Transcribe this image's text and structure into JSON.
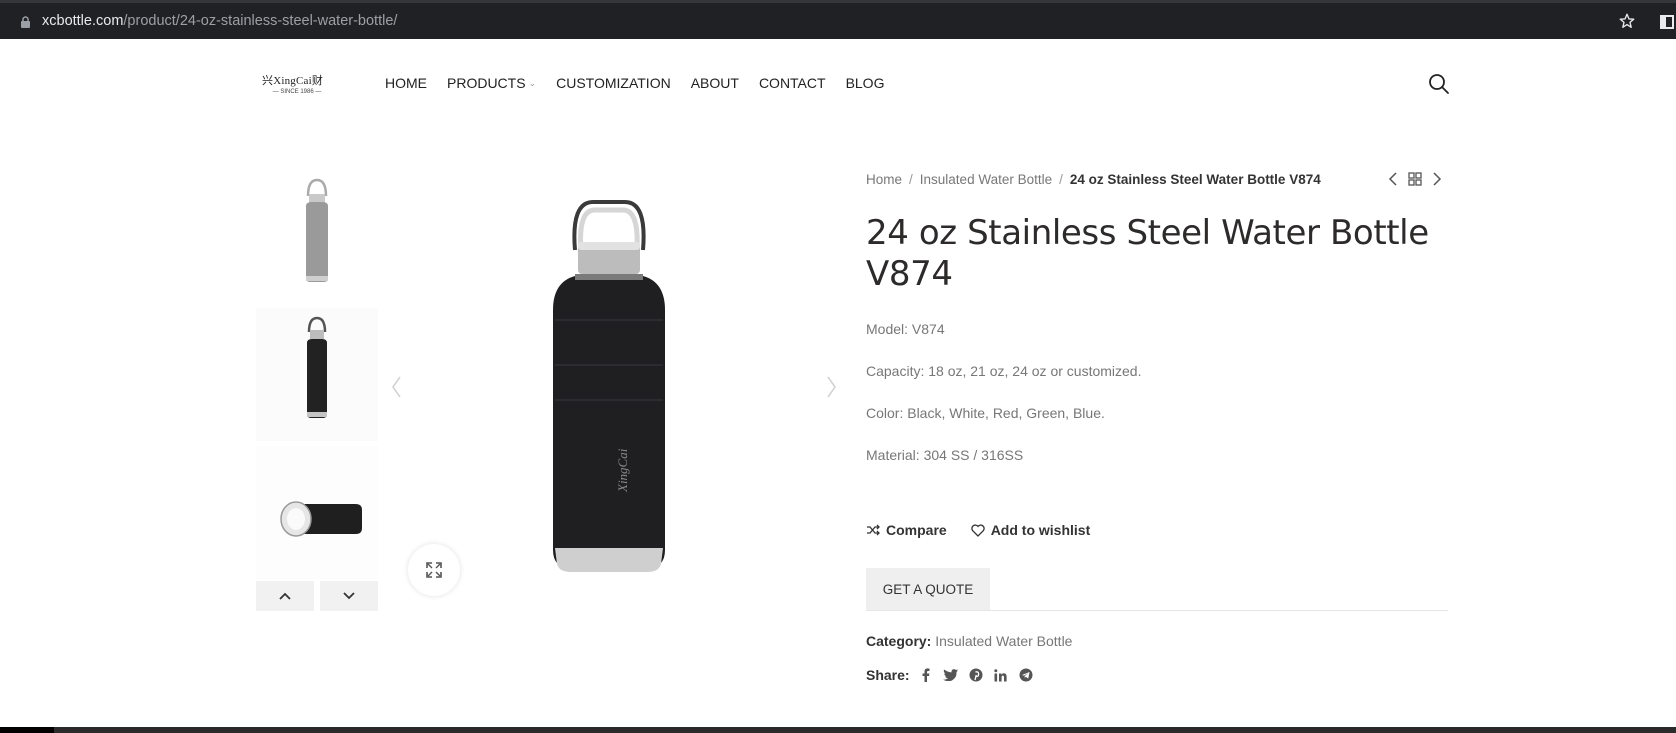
{
  "browser": {
    "url_host": "xcbottle.com",
    "url_path": "/product/24-oz-stainless-steel-water-bottle/"
  },
  "header": {
    "logo_text": "兴XingCai财",
    "logo_tagline": "— SINCE 1986 —",
    "nav": [
      {
        "label": "HOME"
      },
      {
        "label": "PRODUCTS",
        "has_dropdown": true
      },
      {
        "label": "CUSTOMIZATION"
      },
      {
        "label": "ABOUT"
      },
      {
        "label": "CONTACT"
      },
      {
        "label": "BLOG"
      }
    ]
  },
  "gallery": {
    "main_image": "black-water-bottle-image",
    "brand_on_bottle": "XingCai",
    "thumbnails": [
      "grey-bottle-thumb",
      "black-bottle-thumb",
      "bottle-lying-thumb"
    ]
  },
  "product": {
    "breadcrumb": [
      "Home",
      "Insulated Water Bottle",
      "24 oz Stainless Steel Water Bottle V874"
    ],
    "title": "24 oz Stainless Steel Water Bottle V874",
    "specs": [
      "Model: V874",
      "Capacity: 18 oz, 21 oz, 24 oz or customized.",
      "Color: Black, White, Red, Green, Blue.",
      "Material: 304 SS / 316SS"
    ],
    "compare_label": "Compare",
    "wishlist_label": "Add to wishlist",
    "quote_label": "GET A QUOTE",
    "category_label": "Category:",
    "category_value": "Insulated Water Bottle",
    "share_label": "Share:",
    "share_icons": [
      "facebook-icon",
      "twitter-icon",
      "pinterest-icon",
      "linkedin-icon",
      "telegram-icon"
    ]
  },
  "colors": {
    "browser_bg": "#202124",
    "button_bg": "#efefef",
    "text_dark": "#333333",
    "text_muted": "#777777"
  }
}
